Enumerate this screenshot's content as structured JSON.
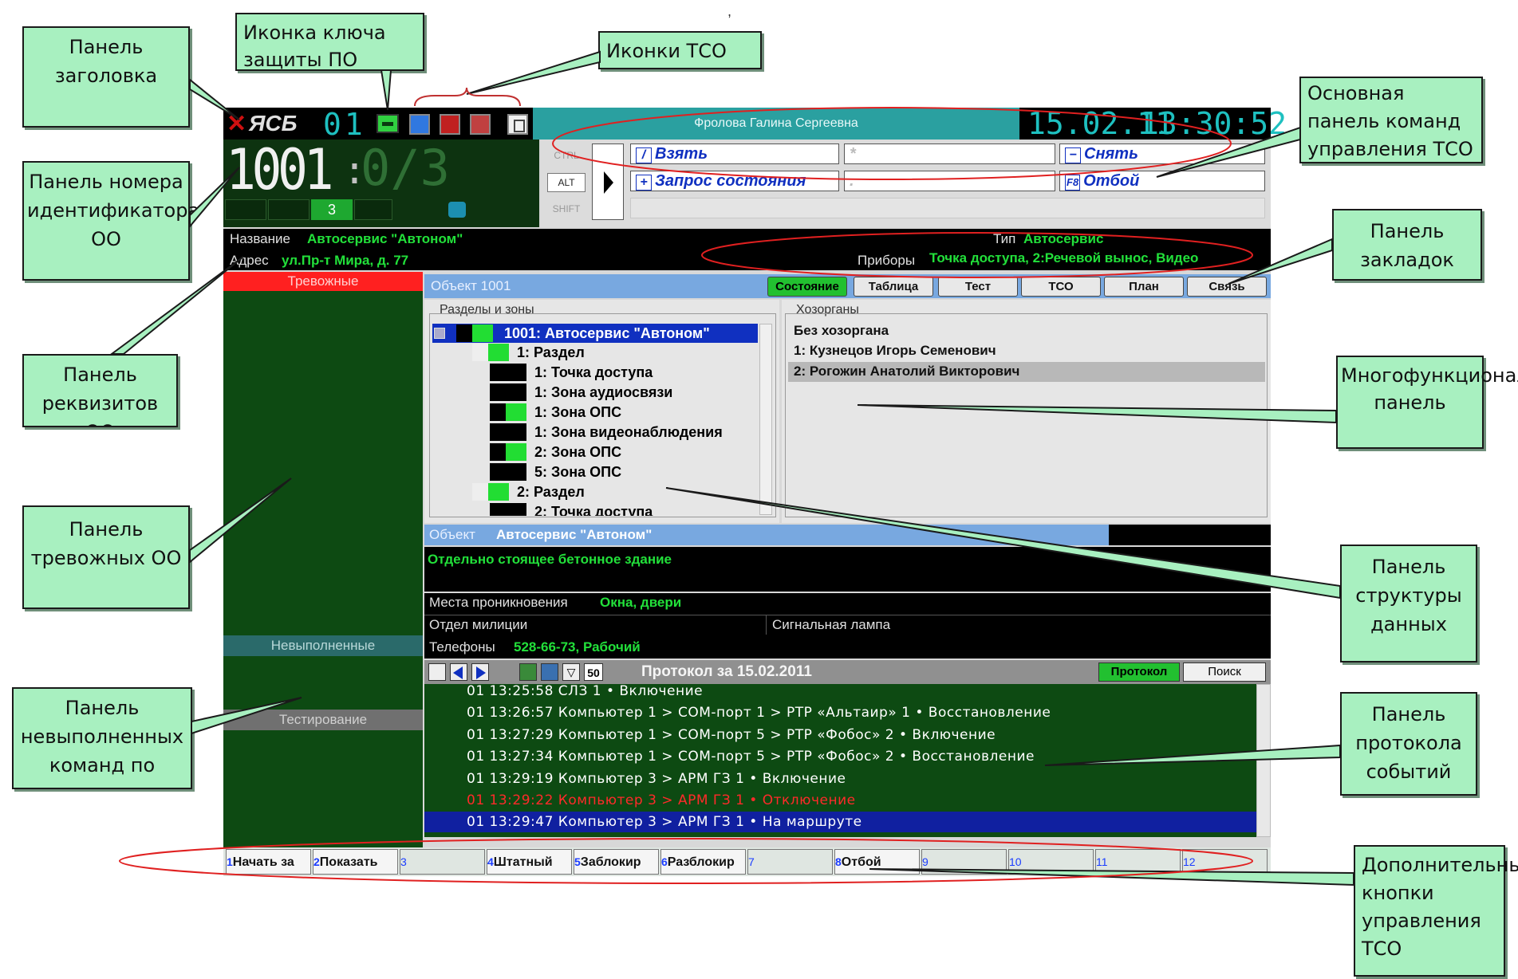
{
  "callouts": {
    "title_panel": "Панель заголовка",
    "key_icon": "Иконка ключа защиты ПО",
    "tso_icons": "Иконки ТСО",
    "main_cmd_panel": "Основная панель команд управления ТСО",
    "id_panel": "Панель номера идентификатора ОО",
    "tabs_panel": "Панель закладок",
    "requisites_panel": "Панель реквизитов ОО",
    "multi_panel": "Многофункциональная панель",
    "alarm_panel": "Панель тревожных ОО",
    "structure_panel": "Панель структуры данных",
    "unfinished_panel": "Панель невыполненных команд по",
    "protocol_panel": "Панель протокола событий",
    "extra_buttons": "Дополнительные кнопки управления ТСО"
  },
  "header": {
    "logo": "ЯСБ",
    "counter": "01",
    "operator": "Фролова Галина Сергеевна",
    "date": "15.02.11",
    "time": "13:30:52"
  },
  "id_panel": {
    "number": "1001",
    "sep": ":",
    "sub": "0/3",
    "mini_value": "3"
  },
  "modifiers": [
    "CTRL",
    "ALT",
    "SHIFT"
  ],
  "commands": {
    "take": "Взять",
    "take_key": "/",
    "query": "Запрос состояния",
    "query_key": "+",
    "star": "*",
    "dot": ".",
    "remove": "Снять",
    "remove_key": "−",
    "cancel": "Отбой",
    "cancel_key": "F8"
  },
  "requisites": {
    "name_label": "Название",
    "name_value": "Автосервис \"Автоном\"",
    "type_label": "Тип",
    "type_value": "Автосервис",
    "address_label": "Адрес",
    "address_value": "ул.Пр-т Мира, д. 77",
    "devices_label": "Приборы",
    "devices_value": "Точка доступа, 2:Речевой вынос, Видео"
  },
  "left_panel": {
    "alarm": "Тревожные",
    "unfinished": "Невыполненные",
    "testing": "Тестирование"
  },
  "object_bar": {
    "title": "Объект 1001"
  },
  "tabs": [
    "Состояние",
    "Таблица",
    "Тест",
    "ТСО",
    "План",
    "Связь"
  ],
  "sections": {
    "title": "Разделы и зоны",
    "root": "1001: Автосервис \"Автоном\"",
    "items": [
      "1: Раздел",
      "1: Точка доступа",
      "1: Зона аудиосвязи",
      "1: Зона ОПС",
      "1: Зона видеонаблюдения",
      "2: Зона ОПС",
      "5: Зона ОПС",
      "2: Раздел",
      "2: Точка доступа"
    ]
  },
  "owners": {
    "title": "Хозорганы",
    "items": [
      "Без хозоргана",
      "1:  Кузнецов Игорь Семенович",
      "2:  Рогожин Анатолий Викторович"
    ]
  },
  "object_info": {
    "title_label": "Объект",
    "title_value": "Автосервис \"Автоном\"",
    "description": "Отдельно стоящее бетонное здание",
    "entry_label": "Места проникновения",
    "entry_value": "Окна, двери",
    "police_label": "Отдел милиции",
    "lamp_label": "Сигнальная лампа",
    "phones_label": "Телефоны",
    "phones_value": "528-66-73, Рабочий"
  },
  "protocol": {
    "count": "50",
    "title": "Протокол за 15.02.2011",
    "btn_protocol": "Протокол",
    "btn_search": "Поиск",
    "rows": [
      {
        "text": "01  13:25:58  СЛЗ 1 • Включение",
        "style": "normal"
      },
      {
        "text": "01  13:26:57  Компьютер 1 > COM-порт 1 > РТР «Альтаир» 1 • Восстановление",
        "style": "normal"
      },
      {
        "text": "01  13:27:29  Компьютер 1 > COM-порт 5 > РТР «Фобос» 2 • Включение",
        "style": "normal"
      },
      {
        "text": "01  13:27:34  Компьютер 1 > COM-порт 5 > РТР «Фобос» 2 • Восстановление",
        "style": "normal"
      },
      {
        "text": "01  13:29:19  Компьютер 3 > АРМ ГЗ 1 • Включение",
        "style": "normal"
      },
      {
        "text": "01  13:29:22  Компьютер 3 > АРМ ГЗ 1 • Отключение",
        "style": "alarm"
      },
      {
        "text": "01  13:29:47  Компьютер 3 > АРМ ГЗ 1 • На маршруте",
        "style": "selected"
      }
    ]
  },
  "fbuttons": [
    {
      "n": "1",
      "label": "Начать за"
    },
    {
      "n": "2",
      "label": "Показать"
    },
    {
      "n": "3",
      "label": ""
    },
    {
      "n": "4",
      "label": "Штатный"
    },
    {
      "n": "5",
      "label": "Заблокир"
    },
    {
      "n": "6",
      "label": "Разблокир"
    },
    {
      "n": "7",
      "label": ""
    },
    {
      "n": "8",
      "label": "Отбой"
    },
    {
      "n": "9",
      "label": ""
    },
    {
      "n": "10",
      "label": ""
    },
    {
      "n": "11",
      "label": ""
    },
    {
      "n": "12",
      "label": ""
    }
  ],
  "colors": {
    "callout": "#a8f0c0",
    "panel_green": "#0d4a12",
    "text_green": "#22e03a",
    "header_teal": "#2aa0a0",
    "alarm_red": "#ff2020",
    "selected_blue": "#1020a0"
  }
}
